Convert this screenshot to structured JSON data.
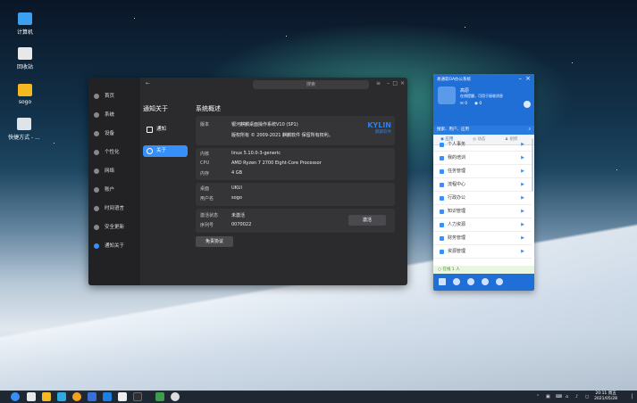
{
  "desktop": {
    "icons": [
      {
        "label": "计算机",
        "icon": "computer-icon"
      },
      {
        "label": "回收站",
        "icon": "trash-icon"
      },
      {
        "label": "sogo",
        "icon": "home-folder-icon"
      },
      {
        "label": "快捷方式 - ...",
        "icon": "shortcut-icon"
      }
    ]
  },
  "settings": {
    "search_placeholder": "搜索",
    "nav": [
      "首页",
      "系统",
      "设备",
      "个性化",
      "网络",
      "账户",
      "时间语言",
      "安全更新",
      "通知关于"
    ],
    "active_nav": "通知关于",
    "middle_title": "通知关于",
    "sub_items": [
      "通知",
      "关于"
    ],
    "active_sub": "关于",
    "content_title": "系统概述",
    "version_label": "版本",
    "version_value": "银河麒麟桌面操作系统V10 (SP1)",
    "copyright": "版权所有 © 2009-2021 麒麟软件 保留所有权利。",
    "logo_text": "KYLIN",
    "logo_sub": "麒麟软件",
    "kernel_label": "内核",
    "kernel_value": "linux 5.10.0-3-generic",
    "cpu_label": "CPU",
    "cpu_value": "AMD Ryzen 7 2700 Eight-Core Processor",
    "memory_label": "内存",
    "memory_value": "4 GB",
    "desktop_label": "桌面",
    "desktop_value": "UKUI",
    "username_label": "用户名",
    "username_value": "sogo",
    "activation_label": "激活状态",
    "activation_value": "未激活",
    "serial_label": "序列号",
    "serial_value": "0070022",
    "activate_button": "激活",
    "agreement_button": "免责协议"
  },
  "oa": {
    "title": "易通软OA办公系统",
    "user_name": "高原",
    "user_status": "在线提醒，可用于接收消息",
    "mail_count": "0",
    "notice_count": "0",
    "search_placeholder": "搜索、用户、应用",
    "tabs": [
      "应用",
      "动态",
      "组织"
    ],
    "menu": [
      "个人事务",
      "我的培训",
      "任务管理",
      "流程中心",
      "行政办公",
      "知识管理",
      "人力资源",
      "财务管理",
      "资源管理"
    ],
    "status": "在线 1 人"
  },
  "taskbar": {
    "time": "20:11 周五",
    "date": "2021/05/28"
  }
}
